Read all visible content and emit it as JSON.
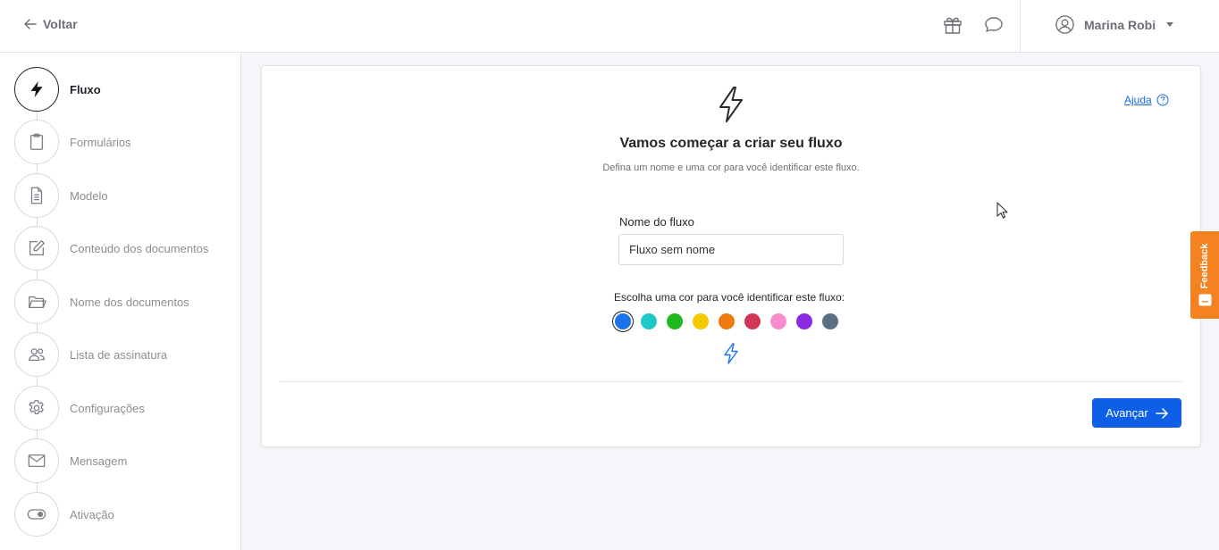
{
  "header": {
    "back_label": "Voltar",
    "user_name": "Marina Robi"
  },
  "sidebar": {
    "steps": [
      {
        "label": "Fluxo",
        "icon": "bolt-icon",
        "active": true
      },
      {
        "label": "Formulários",
        "icon": "clipboard-icon",
        "active": false
      },
      {
        "label": "Modelo",
        "icon": "document-icon",
        "active": false
      },
      {
        "label": "Conteúdo dos documentos",
        "icon": "edit-icon",
        "active": false
      },
      {
        "label": "Nome dos documentos",
        "icon": "folder-icon",
        "active": false
      },
      {
        "label": "Lista de assinatura",
        "icon": "users-icon",
        "active": false
      },
      {
        "label": "Configurações",
        "icon": "gear-icon",
        "active": false
      },
      {
        "label": "Mensagem",
        "icon": "mail-icon",
        "active": false
      },
      {
        "label": "Ativação",
        "icon": "toggle-icon",
        "active": false
      }
    ]
  },
  "main": {
    "help_label": "Ajuda",
    "title": "Vamos começar a criar seu fluxo",
    "subtitle": "Defina um nome e uma cor para você identificar este fluxo.",
    "name_label": "Nome do fluxo",
    "name_value": "Fluxo sem nome",
    "color_label": "Escolha uma cor para você identificar este fluxo:",
    "colors": [
      "#1a73e8",
      "#1fc8c8",
      "#1cb81c",
      "#f5c800",
      "#f07a12",
      "#d2345a",
      "#f78ccf",
      "#8a2be2",
      "#5b7183"
    ],
    "selected_color": "#1a73e8",
    "next_label": "Avançar"
  },
  "feedback_label": "Feedback"
}
